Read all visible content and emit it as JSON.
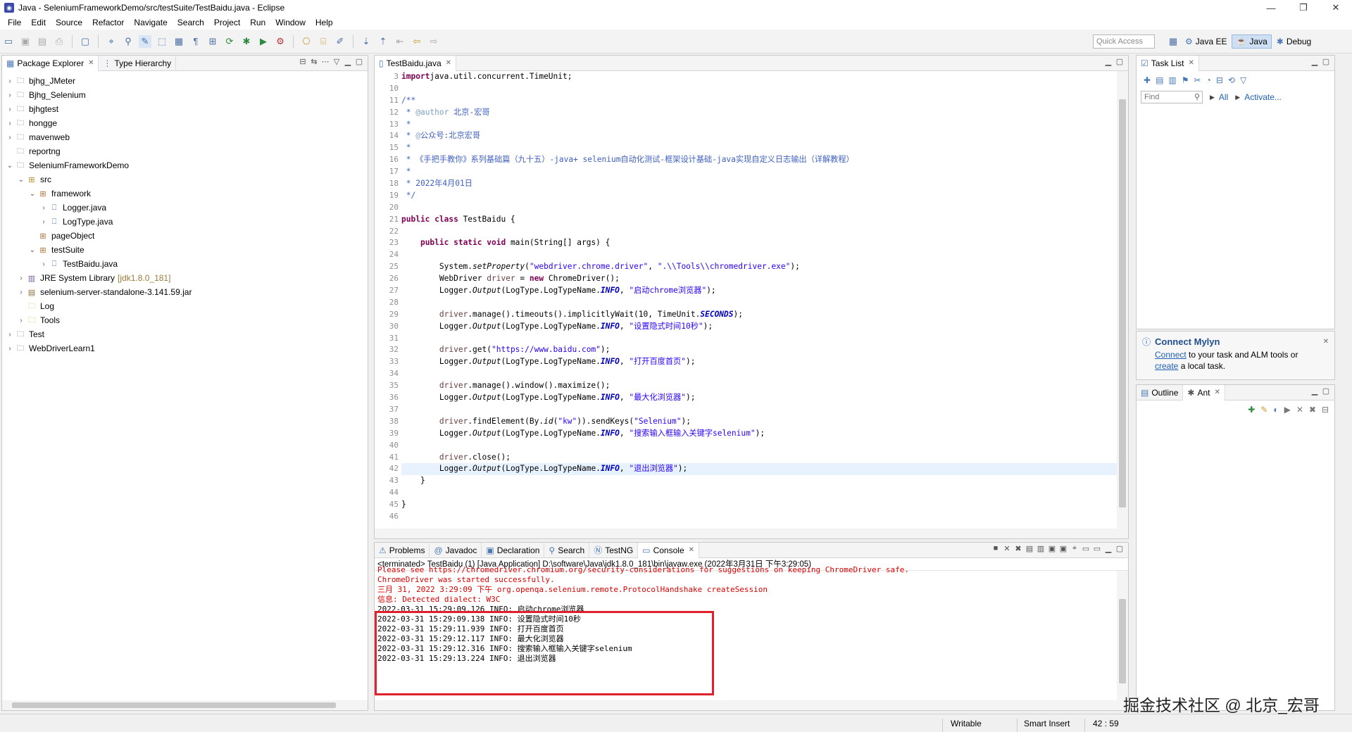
{
  "window": {
    "title": "Java - SeleniumFrameworkDemo/src/testSuite/TestBaidu.java - Eclipse",
    "minimize": "—",
    "restore": "❐",
    "close": "✕"
  },
  "menu": [
    "File",
    "Edit",
    "Source",
    "Refactor",
    "Navigate",
    "Search",
    "Project",
    "Run",
    "Window",
    "Help"
  ],
  "toolbar": {
    "quick_access_placeholder": "Quick Access",
    "perspectives": [
      {
        "label": "Java EE",
        "active": false
      },
      {
        "label": "Java",
        "active": true
      },
      {
        "label": "Debug",
        "active": false
      }
    ]
  },
  "package_explorer": {
    "tabs": [
      "Package Explorer",
      "Type Hierarchy"
    ],
    "tree": [
      {
        "label": "bjhg_JMeter",
        "depth": 0,
        "arrow": ">",
        "icon": "project"
      },
      {
        "label": "Bjhg_Selenium",
        "depth": 0,
        "arrow": ">",
        "icon": "project"
      },
      {
        "label": "bjhgtest",
        "depth": 0,
        "arrow": ">",
        "icon": "project"
      },
      {
        "label": "hongge",
        "depth": 0,
        "arrow": ">",
        "icon": "project"
      },
      {
        "label": "mavenweb",
        "depth": 0,
        "arrow": ">",
        "icon": "project"
      },
      {
        "label": "reportng",
        "depth": 0,
        "arrow": "",
        "icon": "project"
      },
      {
        "label": "SeleniumFrameworkDemo",
        "depth": 0,
        "arrow": "v",
        "icon": "project"
      },
      {
        "label": "src",
        "depth": 1,
        "arrow": "v",
        "icon": "src"
      },
      {
        "label": "framework",
        "depth": 2,
        "arrow": "v",
        "icon": "package"
      },
      {
        "label": "Logger.java",
        "depth": 3,
        "arrow": ">",
        "icon": "java"
      },
      {
        "label": "LogType.java",
        "depth": 3,
        "arrow": ">",
        "icon": "java"
      },
      {
        "label": "pageObject",
        "depth": 2,
        "arrow": "",
        "icon": "package"
      },
      {
        "label": "testSuite",
        "depth": 2,
        "arrow": "v",
        "icon": "package"
      },
      {
        "label": "TestBaidu.java",
        "depth": 3,
        "arrow": ">",
        "icon": "java"
      },
      {
        "label": "JRE System Library",
        "depth": 1,
        "arrow": ">",
        "icon": "library",
        "suffix": "[jdk1.8.0_181]"
      },
      {
        "label": "selenium-server-standalone-3.141.59.jar",
        "depth": 1,
        "arrow": ">",
        "icon": "jar"
      },
      {
        "label": "Log",
        "depth": 1,
        "arrow": "",
        "icon": "folder"
      },
      {
        "label": "Tools",
        "depth": 1,
        "arrow": ">",
        "icon": "folder"
      },
      {
        "label": "Test",
        "depth": 0,
        "arrow": ">",
        "icon": "project"
      },
      {
        "label": "WebDriverLearn1",
        "depth": 0,
        "arrow": ">",
        "icon": "project"
      }
    ]
  },
  "editor": {
    "tab": "TestBaidu.java",
    "lines": [
      {
        "n": "3",
        "segs": [
          [
            "kw",
            "import"
          ],
          [
            "",
            "java.util.concurrent.TimeUnit;"
          ]
        ]
      },
      {
        "n": "10",
        "segs": []
      },
      {
        "n": "11",
        "segs": [
          [
            "jd",
            "/**"
          ]
        ]
      },
      {
        "n": "12",
        "segs": [
          [
            "jd",
            " * "
          ],
          [
            "tag",
            "@author"
          ],
          [
            "jd",
            " 北京-宏哥"
          ]
        ]
      },
      {
        "n": "13",
        "segs": [
          [
            "jd",
            " *"
          ]
        ]
      },
      {
        "n": "14",
        "segs": [
          [
            "jd",
            " * "
          ],
          [
            "tag",
            "@"
          ],
          [
            "jd",
            "公众号:北京宏哥"
          ]
        ]
      },
      {
        "n": "15",
        "segs": [
          [
            "jd",
            " *"
          ]
        ]
      },
      {
        "n": "16",
        "segs": [
          [
            "jd",
            " * 《手把手教你》系列基础篇（九十五）-java+ selenium自动化测试-框架设计基础-java实现自定义日志输出（详解教程）"
          ]
        ]
      },
      {
        "n": "17",
        "segs": [
          [
            "jd",
            " *"
          ]
        ]
      },
      {
        "n": "18",
        "segs": [
          [
            "jd",
            " * 2022年4月01日"
          ]
        ]
      },
      {
        "n": "19",
        "segs": [
          [
            "jd",
            " */"
          ]
        ]
      },
      {
        "n": "20",
        "segs": []
      },
      {
        "n": "21",
        "segs": [
          [
            "kw",
            "public class"
          ],
          [
            "",
            " TestBaidu {"
          ]
        ]
      },
      {
        "n": "22",
        "segs": []
      },
      {
        "n": "23",
        "segs": [
          [
            "",
            "    "
          ],
          [
            "kw",
            "public static void"
          ],
          [
            "",
            " main(String[] args) {"
          ]
        ]
      },
      {
        "n": "24",
        "segs": []
      },
      {
        "n": "25",
        "segs": [
          [
            "",
            "        System."
          ],
          [
            "it",
            "setProperty"
          ],
          [
            "",
            "("
          ],
          [
            "str",
            "\"webdriver.chrome.driver\""
          ],
          [
            "",
            ", "
          ],
          [
            "str",
            "\".\\\\Tools\\\\chromedriver.exe\""
          ],
          [
            "",
            ");"
          ]
        ]
      },
      {
        "n": "26",
        "segs": [
          [
            "",
            "        WebDriver "
          ],
          [
            "var",
            "driver"
          ],
          [
            "",
            " = "
          ],
          [
            "kw",
            "new"
          ],
          [
            "",
            " ChromeDriver();"
          ]
        ]
      },
      {
        "n": "27",
        "segs": [
          [
            "",
            "        Logger."
          ],
          [
            "it",
            "Output"
          ],
          [
            "",
            "(LogType.LogTypeName."
          ],
          [
            "fld",
            "INFO"
          ],
          [
            "",
            ", "
          ],
          [
            "str",
            "\"启动chrome浏览器\""
          ],
          [
            "",
            ");"
          ]
        ]
      },
      {
        "n": "28",
        "segs": []
      },
      {
        "n": "29",
        "segs": [
          [
            "",
            "        "
          ],
          [
            "var",
            "driver"
          ],
          [
            "",
            ".manage().timeouts().implicitlyWait(10, TimeUnit."
          ],
          [
            "fld",
            "SECONDS"
          ],
          [
            "",
            ");"
          ]
        ]
      },
      {
        "n": "30",
        "segs": [
          [
            "",
            "        Logger."
          ],
          [
            "it",
            "Output"
          ],
          [
            "",
            "(LogType.LogTypeName."
          ],
          [
            "fld",
            "INFO"
          ],
          [
            "",
            ", "
          ],
          [
            "str",
            "\"设置隐式时间10秒\""
          ],
          [
            "",
            ");"
          ]
        ]
      },
      {
        "n": "31",
        "segs": []
      },
      {
        "n": "32",
        "segs": [
          [
            "",
            "        "
          ],
          [
            "var",
            "driver"
          ],
          [
            "",
            ".get("
          ],
          [
            "str",
            "\"https://www.baidu.com\""
          ],
          [
            "",
            ");"
          ]
        ]
      },
      {
        "n": "33",
        "segs": [
          [
            "",
            "        Logger."
          ],
          [
            "it",
            "Output"
          ],
          [
            "",
            "(LogType.LogTypeName."
          ],
          [
            "fld",
            "INFO"
          ],
          [
            "",
            ", "
          ],
          [
            "str",
            "\"打开百度首页\""
          ],
          [
            "",
            ");"
          ]
        ]
      },
      {
        "n": "34",
        "segs": []
      },
      {
        "n": "35",
        "segs": [
          [
            "",
            "        "
          ],
          [
            "var",
            "driver"
          ],
          [
            "",
            ".manage().window().maximize();"
          ]
        ]
      },
      {
        "n": "36",
        "segs": [
          [
            "",
            "        Logger."
          ],
          [
            "it",
            "Output"
          ],
          [
            "",
            "(LogType.LogTypeName."
          ],
          [
            "fld",
            "INFO"
          ],
          [
            "",
            ", "
          ],
          [
            "str",
            "\"最大化浏览器\""
          ],
          [
            "",
            ");"
          ]
        ]
      },
      {
        "n": "37",
        "segs": []
      },
      {
        "n": "38",
        "segs": [
          [
            "",
            "        "
          ],
          [
            "var",
            "driver"
          ],
          [
            "",
            ".findElement(By."
          ],
          [
            "it",
            "id"
          ],
          [
            "",
            "("
          ],
          [
            "str",
            "\"kw\""
          ],
          [
            "",
            ")).sendKeys("
          ],
          [
            "str",
            "\"Selenium\""
          ],
          [
            "",
            ");"
          ]
        ]
      },
      {
        "n": "39",
        "segs": [
          [
            "",
            "        Logger."
          ],
          [
            "it",
            "Output"
          ],
          [
            "",
            "(LogType.LogTypeName."
          ],
          [
            "fld",
            "INFO"
          ],
          [
            "",
            ", "
          ],
          [
            "str",
            "\"搜索输入框输入关键字selenium\""
          ],
          [
            "",
            ");"
          ]
        ]
      },
      {
        "n": "40",
        "segs": []
      },
      {
        "n": "41",
        "segs": [
          [
            "",
            "        "
          ],
          [
            "var",
            "driver"
          ],
          [
            "",
            ".close();"
          ]
        ]
      },
      {
        "n": "42",
        "segs": [
          [
            "",
            "        Logger."
          ],
          [
            "it",
            "Output"
          ],
          [
            "",
            "(LogType.LogTypeName."
          ],
          [
            "fld",
            "INFO"
          ],
          [
            "",
            ", "
          ],
          [
            "str",
            "\"退出浏览器\""
          ],
          [
            "",
            ");"
          ]
        ],
        "current": true
      },
      {
        "n": "43",
        "segs": [
          [
            "",
            "    }"
          ]
        ]
      },
      {
        "n": "44",
        "segs": []
      },
      {
        "n": "45",
        "segs": [
          [
            "",
            "}"
          ]
        ]
      },
      {
        "n": "46",
        "segs": []
      }
    ]
  },
  "task_list": {
    "tab": "Task List",
    "find_placeholder": "Find",
    "all_label": "All",
    "activate_label": "Activate..."
  },
  "mylyn": {
    "title": "Connect Mylyn",
    "connect": "Connect",
    "text1": " to your task and ALM tools or",
    "create": "create",
    "text2": " a local task."
  },
  "outline": {
    "tabs": [
      "Outline",
      "Ant"
    ]
  },
  "bottom": {
    "tabs": [
      "Problems",
      "Javadoc",
      "Declaration",
      "Search",
      "TestNG",
      "Console"
    ],
    "active_tab": "Console",
    "console_header": "<terminated> TestBaidu (1) [Java Application] D:\\software\\Java\\jdk1.8.0_181\\bin\\javaw.exe (2022年3月31日 下午3:29:05)",
    "console_lines": [
      {
        "text": "Please see https://chromedriver.chromium.org/security-considerations for suggestions on keeping ChromeDriver safe.",
        "color": "red"
      },
      {
        "text": "ChromeDriver was started successfully.",
        "color": "red"
      },
      {
        "text": "三月 31, 2022 3:29:09 下午 org.openqa.selenium.remote.ProtocolHandshake createSession",
        "color": "red"
      },
      {
        "text": "信息: Detected dialect: W3C",
        "color": "red"
      },
      {
        "text": "2022-03-31 15:29:09.126 INFO: 启动chrome浏览器",
        "color": "black"
      },
      {
        "text": "2022-03-31 15:29:09.138 INFO: 设置隐式时间10秒",
        "color": "black"
      },
      {
        "text": "2022-03-31 15:29:11.939 INFO: 打开百度首页",
        "color": "black"
      },
      {
        "text": "2022-03-31 15:29:12.117 INFO: 最大化浏览器",
        "color": "black"
      },
      {
        "text": "2022-03-31 15:29:12.316 INFO: 搜索输入框输入关键字selenium",
        "color": "black"
      },
      {
        "text": "2022-03-31 15:29:13.224 INFO: 退出浏览器",
        "color": "black"
      }
    ]
  },
  "status": {
    "writable": "Writable",
    "insert_mode": "Smart Insert",
    "position": "42 : 59"
  },
  "watermark": "掘金技术社区 @ 北京_宏哥",
  "colors": {
    "highlight_box": "#e0202a",
    "current_line": "#e8f2fe"
  }
}
